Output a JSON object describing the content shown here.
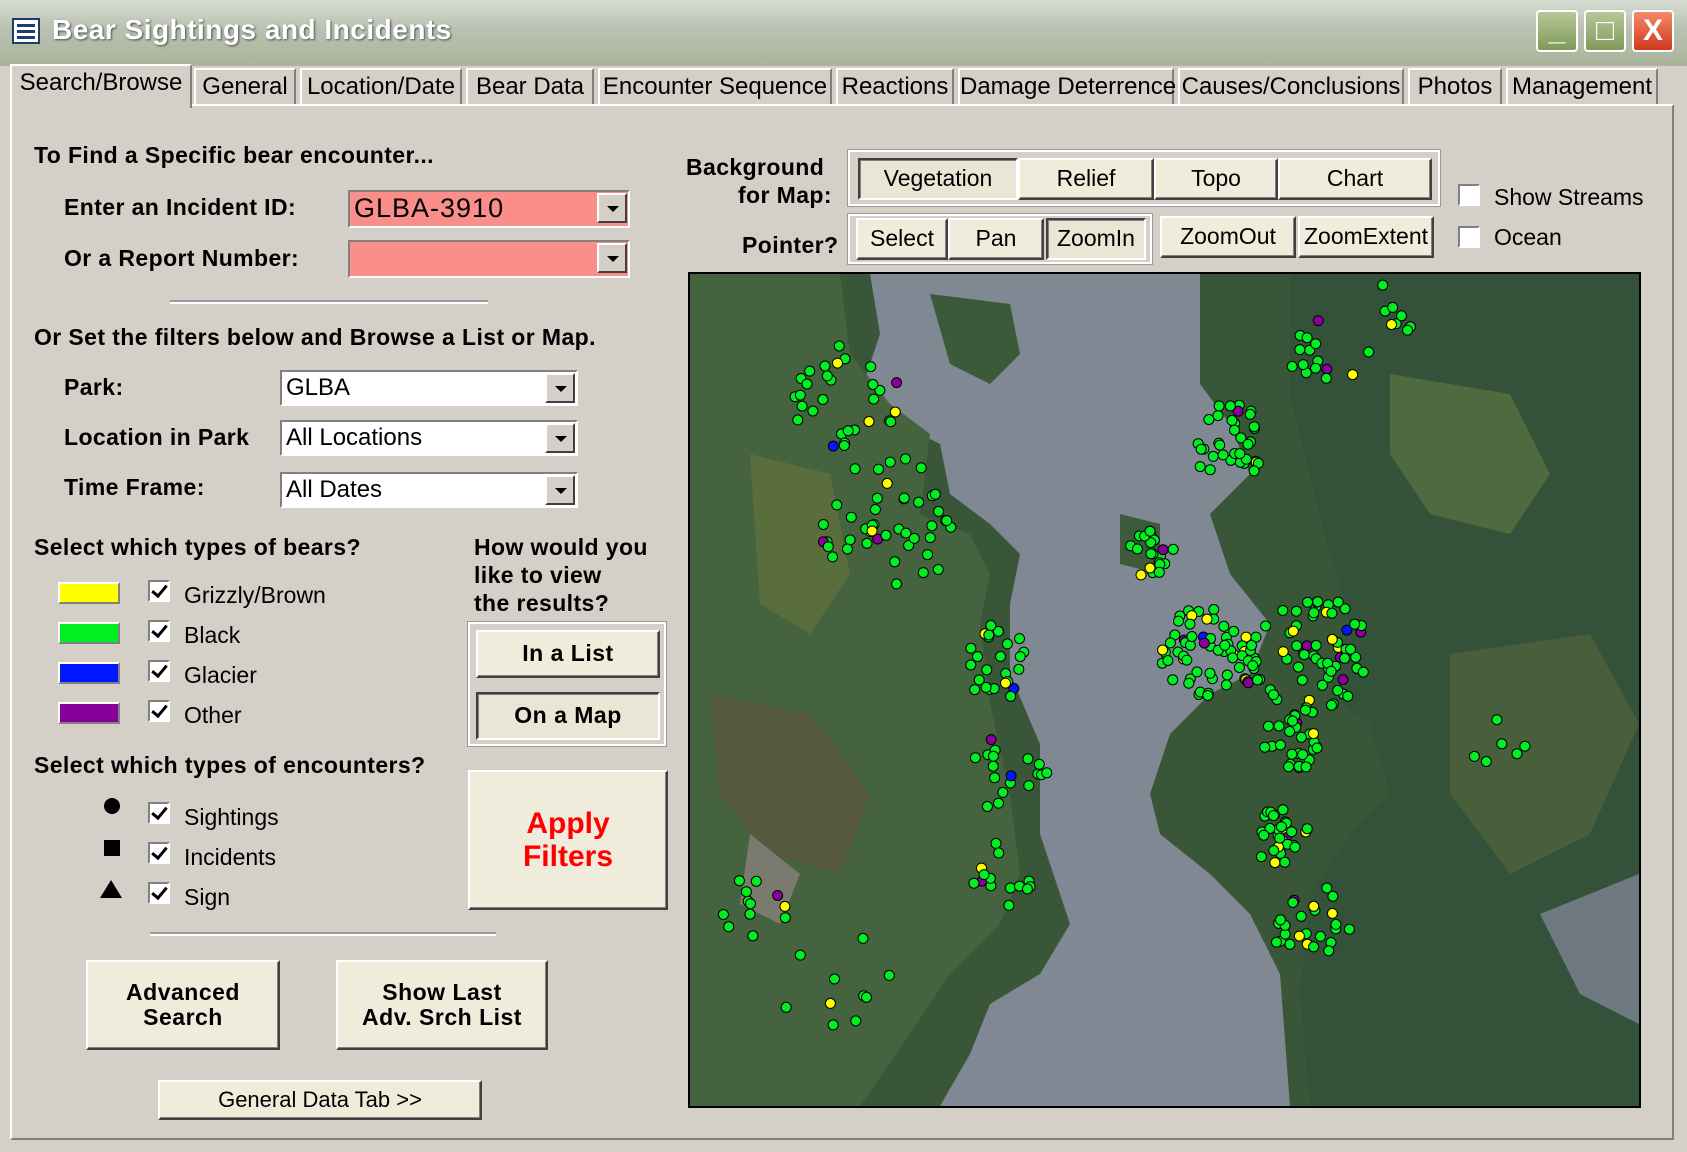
{
  "window": {
    "title": "Bear Sightings and Incidents",
    "minimize": "_",
    "maximize": "□",
    "close": "X"
  },
  "tabs": [
    {
      "label": "Search/Browse",
      "active": true
    },
    {
      "label": "General"
    },
    {
      "label": "Location/Date"
    },
    {
      "label": "Bear Data"
    },
    {
      "label": "Encounter Sequence"
    },
    {
      "label": "Reactions"
    },
    {
      "label": "Damage Deterrence"
    },
    {
      "label": "Causes/Conclusions"
    },
    {
      "label": "Photos"
    },
    {
      "label": "Management"
    }
  ],
  "find": {
    "heading": "To Find a Specific bear encounter...",
    "incident_label": "Enter an Incident ID:",
    "incident_value": "GLBA-3910",
    "report_label": "Or a  Report Number:",
    "report_value": ""
  },
  "filters": {
    "heading": "Or Set the filters below and Browse a List or Map.",
    "park_label": "Park:",
    "park_value": "GLBA",
    "location_label": "Location in Park",
    "location_value": "All Locations",
    "time_label": "Time Frame:",
    "time_value": "All Dates"
  },
  "bear_types": {
    "heading": "Select which types of bears?",
    "items": [
      {
        "label": "Grizzly/Brown",
        "color": "#ffff00",
        "checked": true
      },
      {
        "label": "Black",
        "color": "#00ee22",
        "checked": true
      },
      {
        "label": "Glacier",
        "color": "#0018ff",
        "checked": true
      },
      {
        "label": "Other",
        "color": "#880099",
        "checked": true
      }
    ]
  },
  "encounter_types": {
    "heading": "Select which types of encounters?",
    "items": [
      {
        "label": "Sightings",
        "icon": "circle-icon",
        "checked": true
      },
      {
        "label": "Incidents",
        "icon": "square-icon",
        "checked": true
      },
      {
        "label": "Sign",
        "icon": "triangle-icon",
        "checked": true
      }
    ]
  },
  "view": {
    "question_line1": "How would you",
    "question_line2": "like to view",
    "question_line3": "the results?",
    "list_button": "In a List",
    "map_button": "On a Map"
  },
  "apply": {
    "line1": "Apply",
    "line2": "Filters",
    "color": "#ff0000"
  },
  "advanced": {
    "search_line1": "Advanced",
    "search_line2": "Search",
    "last_line1": "Show Last",
    "last_line2": "Adv. Srch List",
    "general_tab_button": "General Data Tab  >>"
  },
  "map_controls": {
    "background_line1": "Background",
    "background_line2": "for Map:",
    "backgrounds": [
      {
        "label": "Vegetation",
        "selected": true
      },
      {
        "label": "Relief"
      },
      {
        "label": "Topo"
      },
      {
        "label": "Chart"
      }
    ],
    "pointer_label": "Pointer?",
    "pointers": [
      {
        "label": "Select"
      },
      {
        "label": "Pan"
      },
      {
        "label": "ZoomIn",
        "selected": true
      }
    ],
    "zoom_out": "ZoomOut",
    "zoom_extent": "ZoomExtent",
    "show_streams": {
      "label": "Show Streams",
      "checked": false
    },
    "ocean": {
      "label": "Ocean",
      "checked": false
    }
  },
  "map": {
    "water_color": "#7d8791",
    "land_color": "#3d5a3a",
    "point_colors": {
      "grizzly": "#ffff00",
      "black": "#00ee22",
      "glacier": "#0018ff",
      "other": "#880099"
    }
  }
}
